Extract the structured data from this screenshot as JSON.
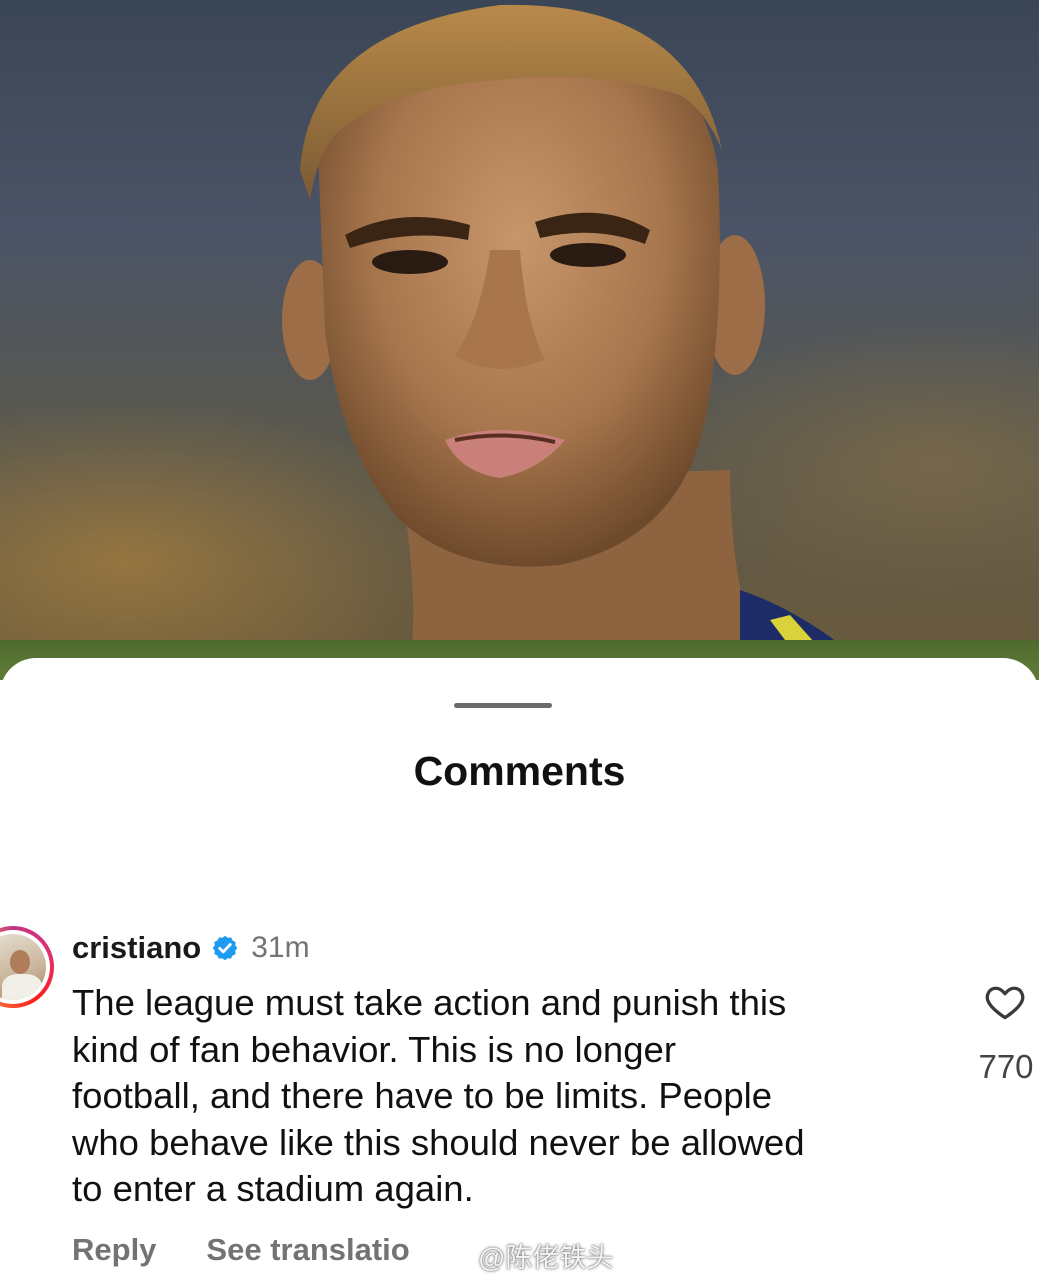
{
  "sheet": {
    "title": "Comments"
  },
  "comment": {
    "username": "cristiano",
    "verified_icon": "verified-badge-icon",
    "time": "31m",
    "text_lines": [
      "The league must take action and punish this",
      "kind of fan behavior. This is no longer",
      "football, and there have to be limits. People",
      "who behave like this should never be allowed",
      "to enter a stadium again."
    ],
    "likes": "770",
    "like_icon": "heart-outline-icon",
    "reply_label": "Reply",
    "translation_label": "See translatio"
  },
  "watermark": {
    "text": "@陈佬铁头"
  },
  "colors": {
    "verified_blue": "#1d9bf0",
    "muted_text": "#737373",
    "story_ring": "#e1306c"
  }
}
